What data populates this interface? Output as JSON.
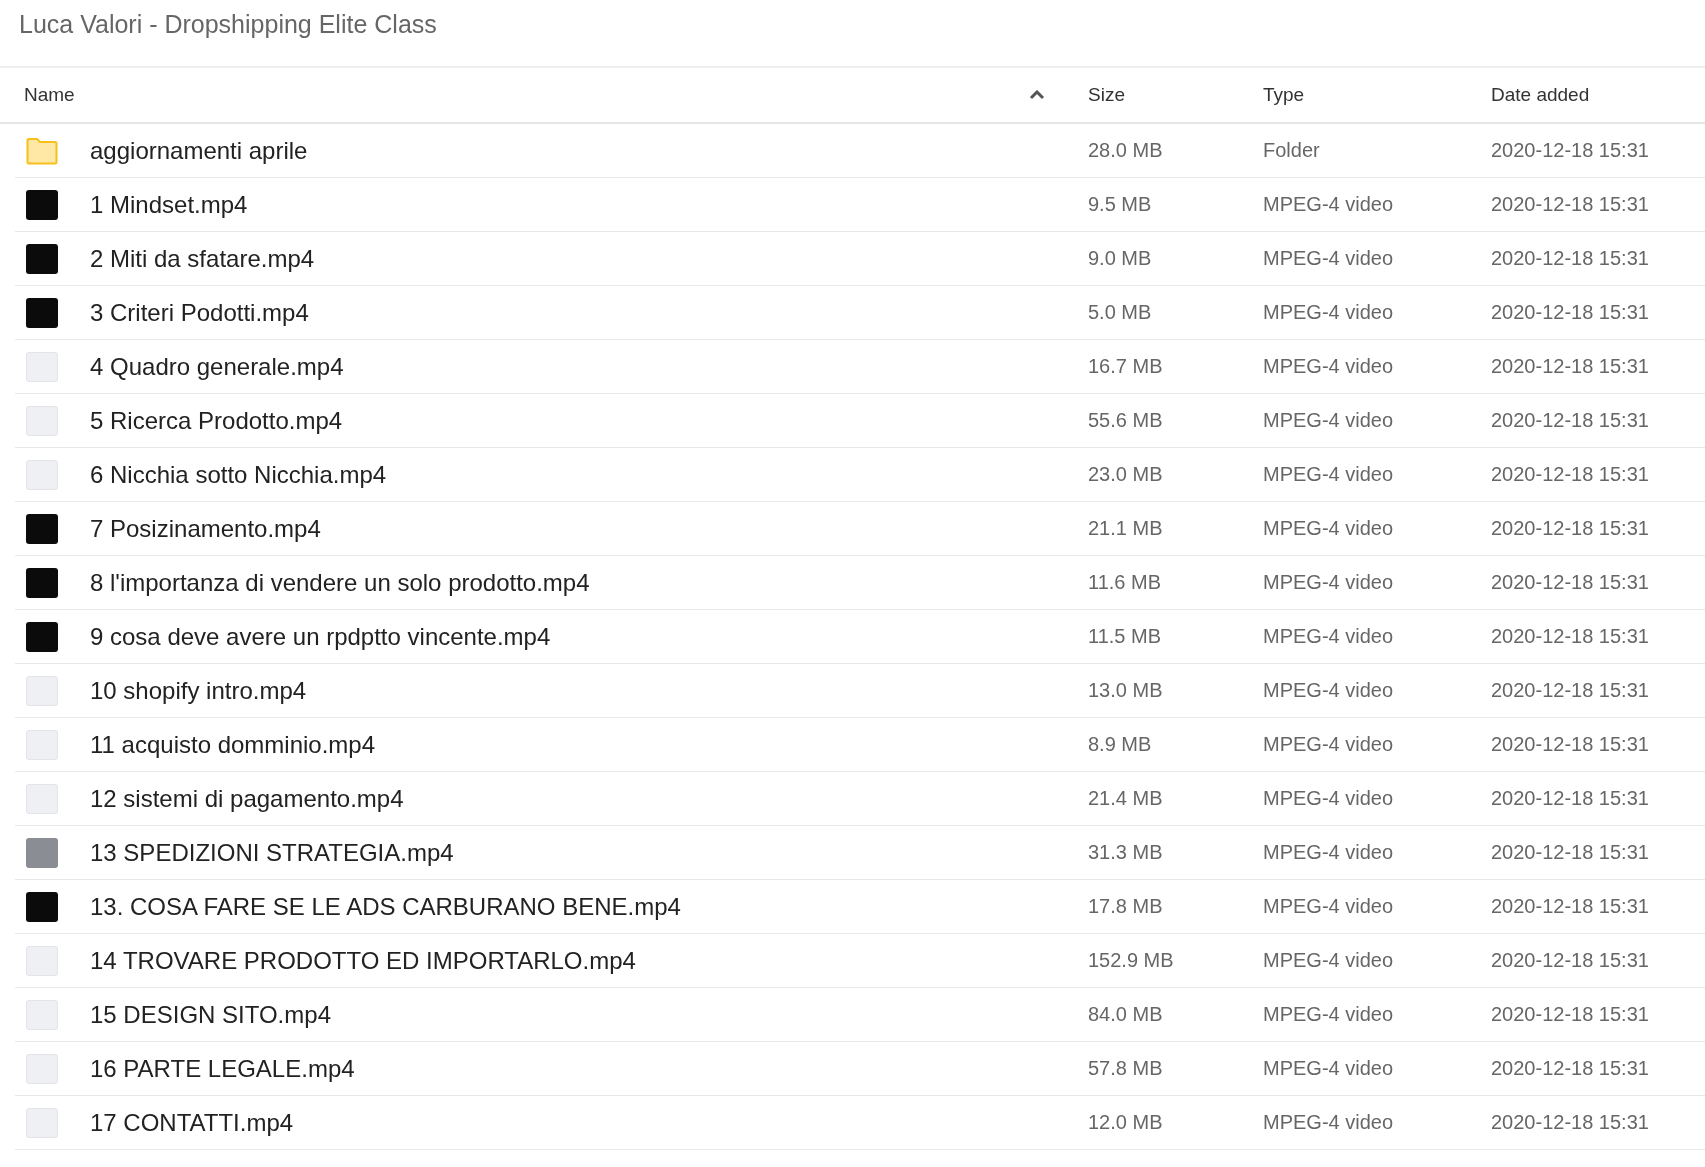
{
  "title": "Luca Valori - Dropshipping Elite Class",
  "table": {
    "columns": [
      {
        "label": "Name",
        "sorted": true
      },
      {
        "label": "Size",
        "sorted": false
      },
      {
        "label": "Type",
        "sorted": false
      },
      {
        "label": "Date added",
        "sorted": false
      }
    ],
    "rows": [
      {
        "kind": "folder",
        "name": "aggiornamenti aprile",
        "size": "28.0 MB",
        "type": "Folder",
        "date": "2020-12-18 15:31"
      },
      {
        "kind": "darkclip",
        "name": "1 Mindset.mp4",
        "size": "9.5 MB",
        "type": "MPEG-4 video",
        "date": "2020-12-18 15:31"
      },
      {
        "kind": "darkclip",
        "name": "2 Miti da sfatare.mp4",
        "size": "9.0 MB",
        "type": "MPEG-4 video",
        "date": "2020-12-18 15:31"
      },
      {
        "kind": "darkclip",
        "name": "3 Criteri Podotti.mp4",
        "size": "5.0 MB",
        "type": "MPEG-4 video",
        "date": "2020-12-18 15:31"
      },
      {
        "kind": "lightclip",
        "name": "4 Quadro generale.mp4",
        "size": "16.7 MB",
        "type": "MPEG-4 video",
        "date": "2020-12-18 15:31"
      },
      {
        "kind": "lightclip",
        "name": "5 Ricerca Prodotto.mp4",
        "size": "55.6 MB",
        "type": "MPEG-4 video",
        "date": "2020-12-18 15:31"
      },
      {
        "kind": "lightclip",
        "name": "6 Nicchia sotto Nicchia.mp4",
        "size": "23.0 MB",
        "type": "MPEG-4 video",
        "date": "2020-12-18 15:31"
      },
      {
        "kind": "darkclip",
        "name": "7 Posizinamento.mp4",
        "size": "21.1 MB",
        "type": "MPEG-4 video",
        "date": "2020-12-18 15:31"
      },
      {
        "kind": "darkclip",
        "name": "8 l'importanza di vendere un solo prodotto.mp4",
        "size": "11.6 MB",
        "type": "MPEG-4 video",
        "date": "2020-12-18 15:31"
      },
      {
        "kind": "darkclip",
        "name": "9 cosa deve avere un rpdptto vincente.mp4",
        "size": "11.5 MB",
        "type": "MPEG-4 video",
        "date": "2020-12-18 15:31"
      },
      {
        "kind": "lightclip",
        "name": "10 shopify intro.mp4",
        "size": "13.0 MB",
        "type": "MPEG-4 video",
        "date": "2020-12-18 15:31"
      },
      {
        "kind": "lightclip",
        "name": "11 acquisto domminio.mp4",
        "size": "8.9 MB",
        "type": "MPEG-4 video",
        "date": "2020-12-18 15:31"
      },
      {
        "kind": "lightclip",
        "name": "12 sistemi di pagamento.mp4",
        "size": "21.4 MB",
        "type": "MPEG-4 video",
        "date": "2020-12-18 15:31"
      },
      {
        "kind": "greyclip",
        "name": "13 SPEDIZIONI STRATEGIA.mp4",
        "size": "31.3 MB",
        "type": "MPEG-4 video",
        "date": "2020-12-18 15:31"
      },
      {
        "kind": "darkclip",
        "name": "13. COSA FARE SE LE ADS CARBURANO BENE.mp4",
        "size": "17.8 MB",
        "type": "MPEG-4 video",
        "date": "2020-12-18 15:31"
      },
      {
        "kind": "lightclip",
        "name": "14 TROVARE PRODOTTO ED IMPORTARLO.mp4",
        "size": "152.9 MB",
        "type": "MPEG-4 video",
        "date": "2020-12-18 15:31"
      },
      {
        "kind": "lightclip",
        "name": "15 DESIGN SITO.mp4",
        "size": "84.0 MB",
        "type": "MPEG-4 video",
        "date": "2020-12-18 15:31"
      },
      {
        "kind": "lightclip",
        "name": "16 PARTE LEGALE.mp4",
        "size": "57.8 MB",
        "type": "MPEG-4 video",
        "date": "2020-12-18 15:31"
      },
      {
        "kind": "lightclip",
        "name": "17 CONTATTI.mp4",
        "size": "12.0 MB",
        "type": "MPEG-4 video",
        "date": "2020-12-18 15:31"
      }
    ]
  }
}
